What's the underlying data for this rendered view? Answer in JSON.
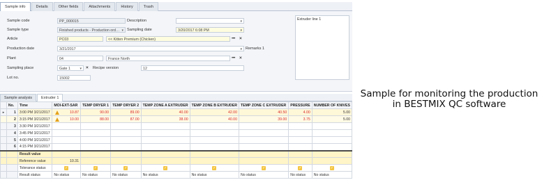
{
  "tabs": [
    "Sample info",
    "Details",
    "Other fields",
    "Attachments",
    "History",
    "Trash"
  ],
  "form": {
    "sample_code_label": "Sample code",
    "sample_code": "PP_000015",
    "description_label": "Description",
    "description": "",
    "sample_type_label": "Sample type",
    "sample_type": "Finished products - Production ord…",
    "sampling_date_label": "Sampling date",
    "sampling_date": "3/20/2017 6:08 PM",
    "article_label": "Article",
    "article_code": "PC03",
    "article_name": "<< Kitten Premium (Chicken)",
    "production_date_label": "Production date",
    "production_date": "3/21/2017",
    "remarks_label": "Remarks 1",
    "remarks": "Extruder line 1",
    "plant_label": "Plant",
    "plant_code": "04",
    "plant_name": "France North",
    "sampling_place_label": "Sampling place",
    "sampling_place": "Gate 1",
    "recipe_version_label": "Recipe version",
    "recipe_version": "12",
    "lot_no_label": "Lot no.",
    "lot_no": "15002"
  },
  "bottom_tabs": [
    "Sample analysis",
    "Extruder 1"
  ],
  "grid": {
    "columns": [
      "No.",
      "Time",
      "MOI-EXT-SAR",
      "TEMP DRYER 1",
      "TEMP DRYER 2",
      "TEMP ZONE A EXTRUDER",
      "TEMP ZONE B EXTRUDER",
      "TEMP ZONE C EXTRUDER",
      "PRESSURE",
      "NUMBER OF KNIVES"
    ],
    "rows": [
      {
        "no": "1",
        "time": "3:00 PM 3/21/2017",
        "moi": "10.87",
        "d1": "90.00",
        "d2": "89.00",
        "za": "40.00",
        "zb": "42.00",
        "zc": "40.50",
        "p": "4.00",
        "k": "5.00"
      },
      {
        "no": "2",
        "time": "3:15 PM 3/21/2017",
        "moi": "10.00",
        "d1": "88.00",
        "d2": "87.00",
        "za": "38.00",
        "zb": "40.00",
        "zc": "39.00",
        "p": "3.75",
        "k": "5.00"
      },
      {
        "no": "3",
        "time": "3:30 PM 3/21/2017",
        "moi": "",
        "d1": "",
        "d2": "",
        "za": "",
        "zb": "",
        "zc": "",
        "p": "",
        "k": ""
      },
      {
        "no": "4",
        "time": "3:45 PM 3/21/2017",
        "moi": "",
        "d1": "",
        "d2": "",
        "za": "",
        "zb": "",
        "zc": "",
        "p": "",
        "k": ""
      },
      {
        "no": "5",
        "time": "4:00 PM 3/21/2017",
        "moi": "",
        "d1": "",
        "d2": "",
        "za": "",
        "zb": "",
        "zc": "",
        "p": "",
        "k": ""
      },
      {
        "no": "6",
        "time": "4:15 PM 3/21/2017",
        "moi": "",
        "d1": "",
        "d2": "",
        "za": "",
        "zb": "",
        "zc": "",
        "p": "",
        "k": ""
      }
    ],
    "summary": {
      "result_value": "Result value",
      "reference_value": "Reference value",
      "reference_moi": "10.31",
      "tolerance_status": "Tolerance status",
      "result_status": "Result status",
      "no_status": "No status"
    }
  },
  "caption": {
    "line1": "Sample for monitoring the production",
    "line2": "in BESTMIX QC software"
  }
}
